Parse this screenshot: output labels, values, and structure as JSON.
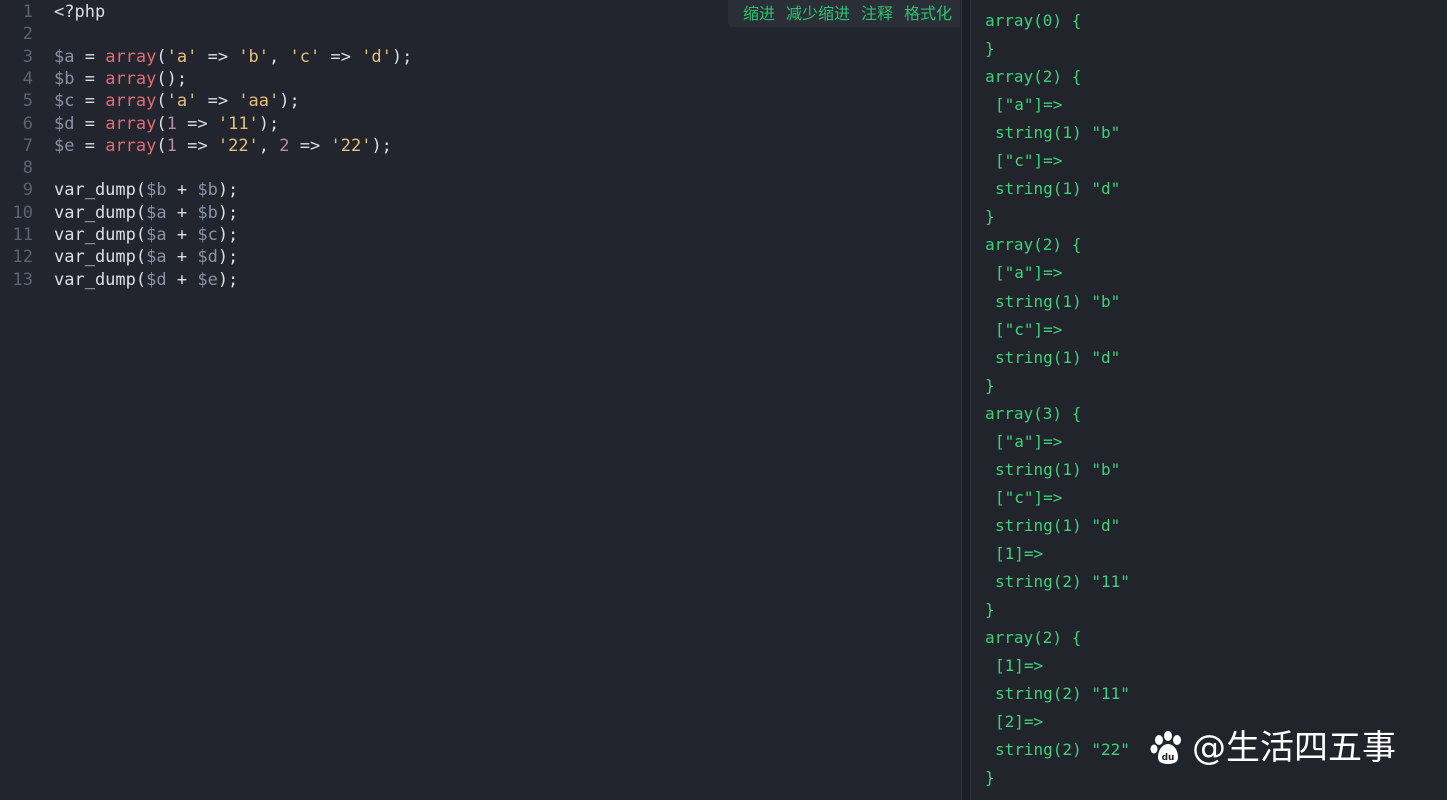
{
  "toolbar": {
    "indent": "缩进",
    "outdent": "减少缩进",
    "comment": "注释",
    "format": "格式化"
  },
  "editor": {
    "line_numbers": [
      "1",
      "2",
      "3",
      "4",
      "5",
      "6",
      "7",
      "8",
      "9",
      "10",
      "11",
      "12",
      "13"
    ],
    "lines": [
      [
        {
          "t": "plain",
          "v": "<?php"
        }
      ],
      [],
      [
        {
          "t": "var",
          "v": "$a"
        },
        {
          "t": "op",
          "v": " = "
        },
        {
          "t": "fn",
          "v": "array"
        },
        {
          "t": "op",
          "v": "("
        },
        {
          "t": "str",
          "v": "'a'"
        },
        {
          "t": "op",
          "v": " => "
        },
        {
          "t": "str",
          "v": "'b'"
        },
        {
          "t": "op",
          "v": ", "
        },
        {
          "t": "str",
          "v": "'c'"
        },
        {
          "t": "op",
          "v": " => "
        },
        {
          "t": "str",
          "v": "'d'"
        },
        {
          "t": "op",
          "v": ");"
        }
      ],
      [
        {
          "t": "var",
          "v": "$b"
        },
        {
          "t": "op",
          "v": " = "
        },
        {
          "t": "fn",
          "v": "array"
        },
        {
          "t": "op",
          "v": "();"
        }
      ],
      [
        {
          "t": "var",
          "v": "$c"
        },
        {
          "t": "op",
          "v": " = "
        },
        {
          "t": "fn",
          "v": "array"
        },
        {
          "t": "op",
          "v": "("
        },
        {
          "t": "str",
          "v": "'a'"
        },
        {
          "t": "op",
          "v": " => "
        },
        {
          "t": "str",
          "v": "'aa'"
        },
        {
          "t": "op",
          "v": ");"
        }
      ],
      [
        {
          "t": "var",
          "v": "$d"
        },
        {
          "t": "op",
          "v": " = "
        },
        {
          "t": "fn",
          "v": "array"
        },
        {
          "t": "op",
          "v": "("
        },
        {
          "t": "num",
          "v": "1"
        },
        {
          "t": "op",
          "v": " => "
        },
        {
          "t": "str",
          "v": "'11'"
        },
        {
          "t": "op",
          "v": ");"
        }
      ],
      [
        {
          "t": "var",
          "v": "$e"
        },
        {
          "t": "op",
          "v": " = "
        },
        {
          "t": "fn",
          "v": "array"
        },
        {
          "t": "op",
          "v": "("
        },
        {
          "t": "num",
          "v": "1"
        },
        {
          "t": "op",
          "v": " => "
        },
        {
          "t": "str",
          "v": "'22'"
        },
        {
          "t": "op",
          "v": ", "
        },
        {
          "t": "num",
          "v": "2"
        },
        {
          "t": "op",
          "v": " => "
        },
        {
          "t": "str",
          "v": "'22'"
        },
        {
          "t": "op",
          "v": ");"
        }
      ],
      [],
      [
        {
          "t": "plain",
          "v": "var_dump("
        },
        {
          "t": "var",
          "v": "$b"
        },
        {
          "t": "op",
          "v": " + "
        },
        {
          "t": "var",
          "v": "$b"
        },
        {
          "t": "op",
          "v": ");"
        }
      ],
      [
        {
          "t": "plain",
          "v": "var_dump("
        },
        {
          "t": "var",
          "v": "$a"
        },
        {
          "t": "op",
          "v": " + "
        },
        {
          "t": "var",
          "v": "$b"
        },
        {
          "t": "op",
          "v": ");"
        }
      ],
      [
        {
          "t": "plain",
          "v": "var_dump("
        },
        {
          "t": "var",
          "v": "$a"
        },
        {
          "t": "op",
          "v": " + "
        },
        {
          "t": "var",
          "v": "$c"
        },
        {
          "t": "op",
          "v": ");"
        }
      ],
      [
        {
          "t": "plain",
          "v": "var_dump("
        },
        {
          "t": "var",
          "v": "$a"
        },
        {
          "t": "op",
          "v": " + "
        },
        {
          "t": "var",
          "v": "$d"
        },
        {
          "t": "op",
          "v": ");"
        }
      ],
      [
        {
          "t": "plain",
          "v": "var_dump("
        },
        {
          "t": "var",
          "v": "$d"
        },
        {
          "t": "op",
          "v": " + "
        },
        {
          "t": "var",
          "v": "$e"
        },
        {
          "t": "op",
          "v": ");"
        }
      ]
    ]
  },
  "output": {
    "lines": [
      {
        "text": "array(0) {",
        "indent": false
      },
      {
        "text": "}",
        "indent": false
      },
      {
        "text": "array(2) {",
        "indent": false
      },
      {
        "text": "[\"a\"]=>",
        "indent": true
      },
      {
        "text": "string(1) \"b\"",
        "indent": true
      },
      {
        "text": "[\"c\"]=>",
        "indent": true
      },
      {
        "text": "string(1) \"d\"",
        "indent": true
      },
      {
        "text": "}",
        "indent": false
      },
      {
        "text": "array(2) {",
        "indent": false
      },
      {
        "text": "[\"a\"]=>",
        "indent": true
      },
      {
        "text": "string(1) \"b\"",
        "indent": true
      },
      {
        "text": "[\"c\"]=>",
        "indent": true
      },
      {
        "text": "string(1) \"d\"",
        "indent": true
      },
      {
        "text": "}",
        "indent": false
      },
      {
        "text": "array(3) {",
        "indent": false
      },
      {
        "text": "[\"a\"]=>",
        "indent": true
      },
      {
        "text": "string(1) \"b\"",
        "indent": true
      },
      {
        "text": "[\"c\"]=>",
        "indent": true
      },
      {
        "text": "string(1) \"d\"",
        "indent": true
      },
      {
        "text": "[1]=>",
        "indent": true
      },
      {
        "text": "string(2) \"11\"",
        "indent": true
      },
      {
        "text": "}",
        "indent": false
      },
      {
        "text": "array(2) {",
        "indent": false
      },
      {
        "text": "[1]=>",
        "indent": true
      },
      {
        "text": "string(2) \"11\"",
        "indent": true
      },
      {
        "text": "[2]=>",
        "indent": true
      },
      {
        "text": "string(2) \"22\"",
        "indent": true
      },
      {
        "text": "}",
        "indent": false
      }
    ]
  },
  "watermark": {
    "icon": "baidu-paw-icon",
    "text": "@生活四五事"
  },
  "colors": {
    "editor_bg": "#22252e",
    "output_text": "#3dd17a",
    "toolbar_text": "#2fbf71",
    "keyword": "#e06c75",
    "string": "#e5c07b",
    "variable": "#8a93a5",
    "number": "#b48ead"
  }
}
